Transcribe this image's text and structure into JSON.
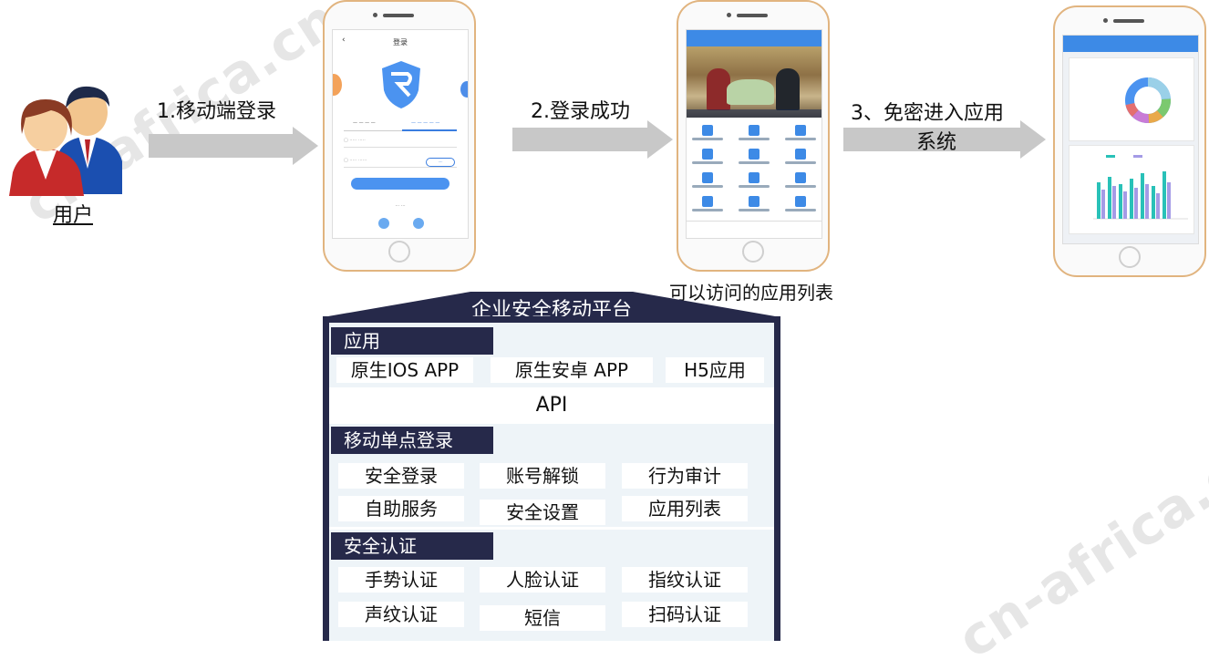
{
  "watermark": {
    "text": "cn-africa.cn"
  },
  "user": {
    "label": "用户"
  },
  "steps": [
    {
      "label": "1.移动端登录"
    },
    {
      "label": "2.登录成功"
    },
    {
      "label": "3、免密进入应用",
      "line2": "系统"
    }
  ],
  "phone2_caption": "可以访问的应用列表",
  "phone1": {
    "title": "登录"
  },
  "platform": {
    "title": "企业安全移动平台",
    "app_section": {
      "header": "应用",
      "items": [
        "原生IOS APP",
        "原生安卓 APP",
        "H5应用"
      ]
    },
    "api_label": "API",
    "sso_section": {
      "header": "移动单点登录",
      "items": [
        "安全登录",
        "账号解锁",
        "行为审计",
        "自助服务",
        "安全设置",
        "应用列表"
      ]
    },
    "auth_section": {
      "header": "安全认证",
      "items": [
        "手势认证",
        "人脸认证",
        "指纹认证",
        "声纹认证",
        "短信",
        "扫码认证"
      ]
    }
  },
  "colors": {
    "platform_dark": "#26294a",
    "platform_light": "#eef4f8",
    "arrow": "#c8c8c8",
    "phone_frame": "#e1b47f",
    "app_blue": "#3d8ae6"
  }
}
